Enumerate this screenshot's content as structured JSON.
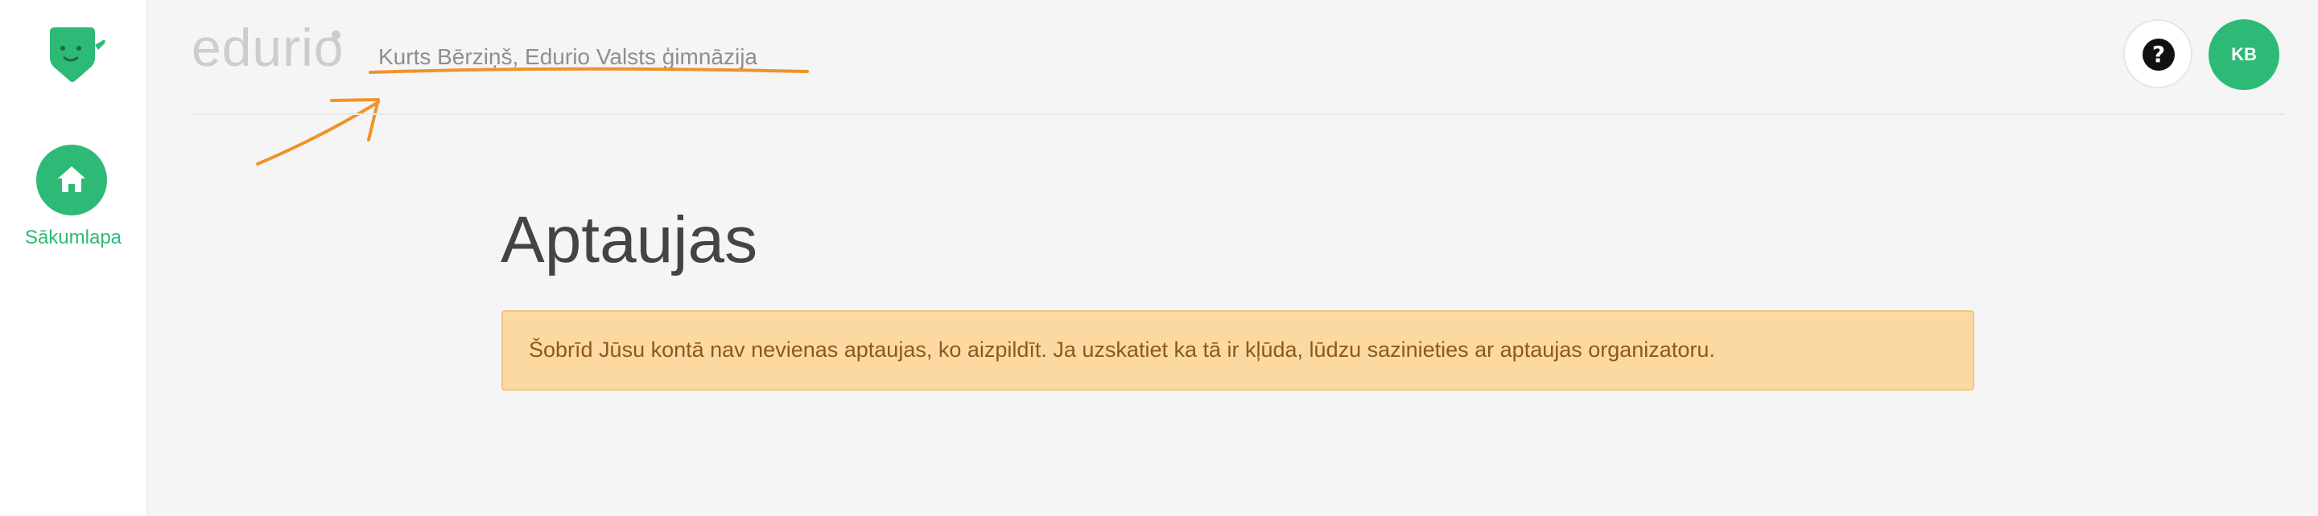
{
  "sidebar": {
    "logo_icon": "edurio-mascot-icon",
    "home": {
      "label": "Sākumlapa",
      "icon": "home-icon"
    }
  },
  "header": {
    "brand": "edurio",
    "user_org": "Kurts Bērziņš, Edurio Valsts ģimnāzija",
    "help_icon": "question-mark-icon",
    "help_label": "?",
    "avatar_initials": "KB"
  },
  "main": {
    "title": "Aptaujas",
    "alert": "Šobrīd Jūsu kontā nav nevienas aptaujas, ko aizpildīt. Ja uzskatiet ka tā ir kļūda, lūdzu sazinieties ar aptaujas organizatoru."
  },
  "colors": {
    "accent": "#2dba76",
    "annotation": "#f0922b",
    "alert_background": "#fdd9a2",
    "alert_text": "#8a5a1c"
  }
}
